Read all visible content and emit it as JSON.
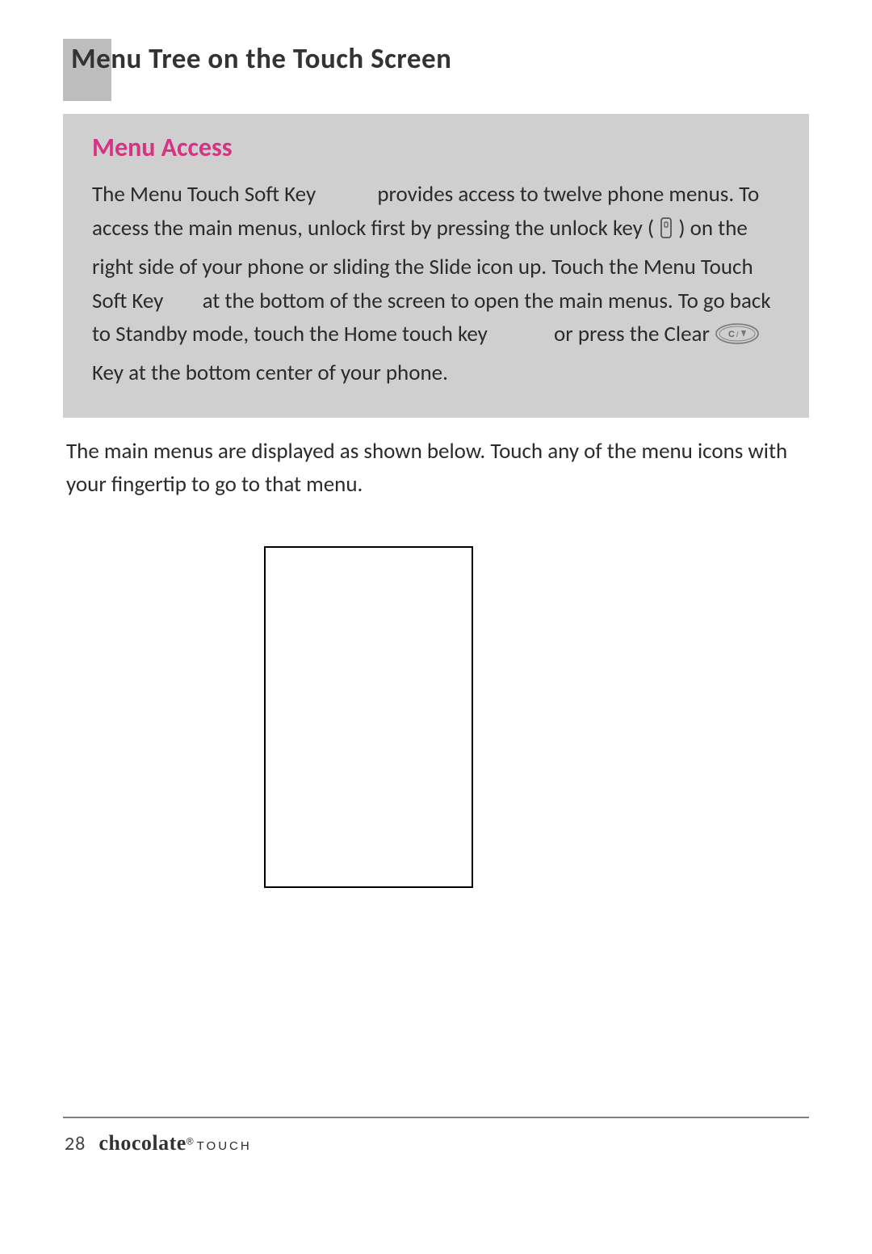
{
  "header": {
    "title": "Menu Tree on the Touch Screen"
  },
  "callout": {
    "heading": "Menu Access",
    "seg1": "The Menu Touch Soft Key ",
    "seg2": " provides access to twelve phone menus. To access the main menus, unlock first by pressing the unlock key ( ",
    "seg3": " ) on the right side of your phone or sliding the Slide icon up. Touch the Menu Touch Soft Key ",
    "seg4": " at the bottom of the screen to open the main menus. To go back to Standby mode, touch the Home touch key ",
    "seg5": " or press the Clear ",
    "seg6": " Key at the bottom center of your phone."
  },
  "below": "The main menus are displayed as shown below. Touch any of the menu icons with your fingertip to go to that menu.",
  "footer": {
    "page": "28",
    "brand": "chocolate",
    "reg": "®",
    "sub": "TOUCH"
  },
  "icons": {
    "lock": "lock-icon",
    "clear_key": "clear-key-icon"
  }
}
